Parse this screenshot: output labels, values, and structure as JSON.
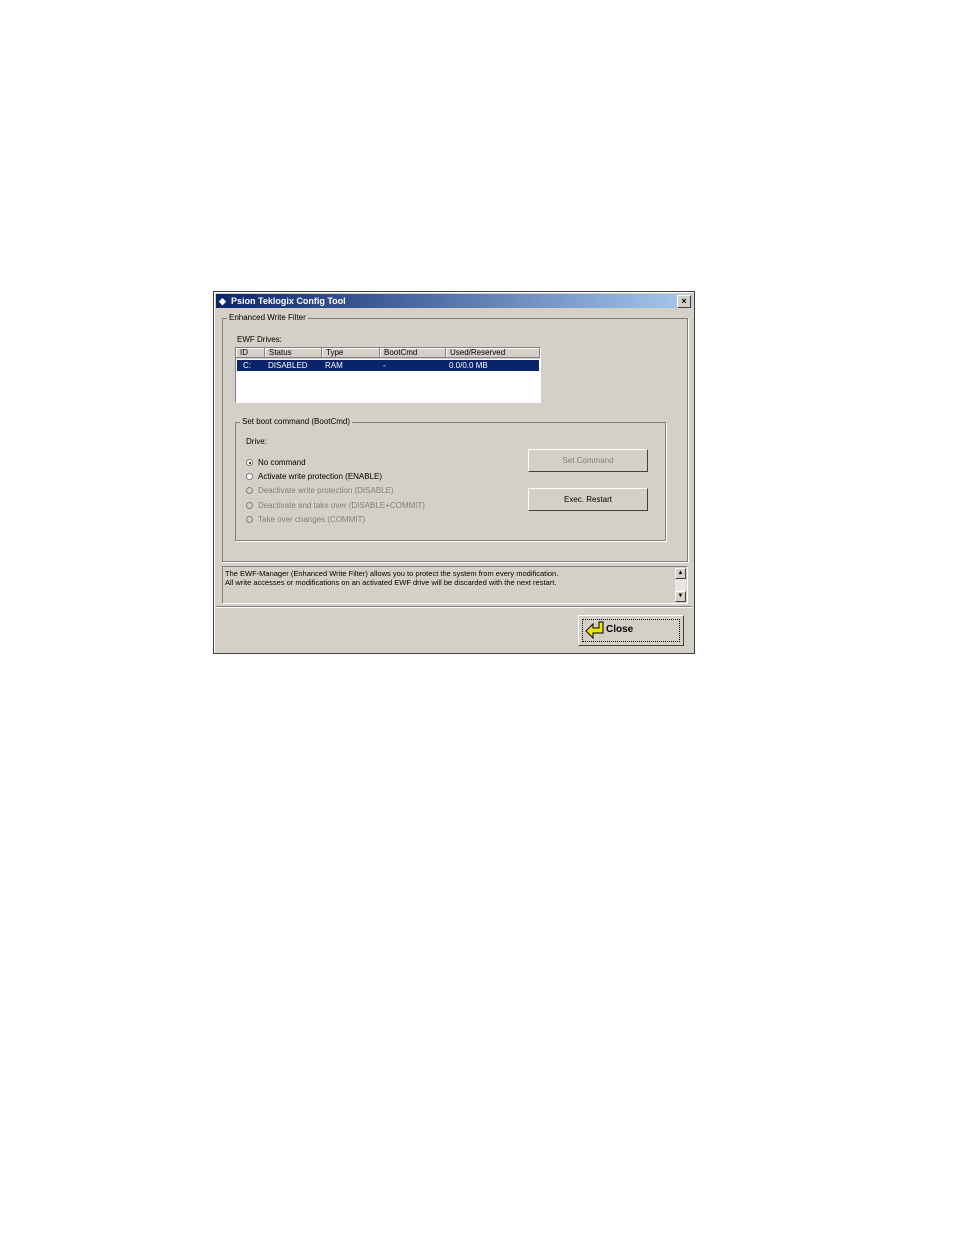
{
  "window": {
    "title": "Psion Teklogix Config Tool",
    "close_glyph": "×"
  },
  "ewf_group": {
    "legend": "Enhanced Write Filter",
    "drives_label": "EWF Drives:"
  },
  "drives_table": {
    "columns": [
      "ID",
      "Status",
      "Type",
      "BootCmd",
      "Used/Reserved"
    ],
    "rows": [
      {
        "id": "C:",
        "status": "DISABLED",
        "type": "RAM",
        "bootcmd": "-",
        "used_reserved": "0.0/0.0 MB",
        "selected": true
      }
    ]
  },
  "boot_group": {
    "legend": "Set boot command (BootCmd)",
    "drive_label": "Drive:",
    "options": [
      {
        "label": "No command",
        "checked": true,
        "enabled": true
      },
      {
        "label": "Activate write protection (ENABLE)",
        "checked": false,
        "enabled": true
      },
      {
        "label": "Deactivate write protection (DISABLE)",
        "checked": false,
        "enabled": false
      },
      {
        "label": "Deactivate and take over (DISABLE+COMMIT)",
        "checked": false,
        "enabled": false
      },
      {
        "label": "Take over changes (COMMIT)",
        "checked": false,
        "enabled": false
      }
    ],
    "set_command_label": "Set Command",
    "exec_restart_label": "Exec. Restart"
  },
  "info": {
    "line1": "The EWF-Manager (Enhanced Write Filter) allows you to protect the system from every modification.",
    "line2": "All write accesses or modifications on an activated EWF drive will be discarded with the next restart."
  },
  "footer": {
    "close_label": "Close",
    "close_icon": "yellow-arrow-icon"
  },
  "colors": {
    "titlebar": "#0a246a",
    "selection": "#0a246a",
    "face": "#d4d0c8"
  }
}
